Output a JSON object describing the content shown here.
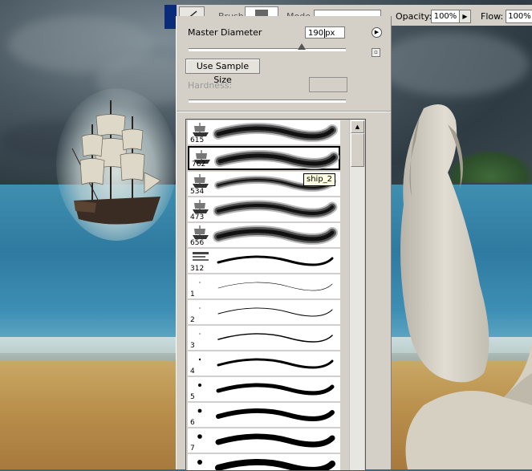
{
  "options_bar": {
    "opacity_label": "Opacity:",
    "opacity_value": "100%",
    "flow_label": "Flow:",
    "flow_value": "100%",
    "mode_label": "Mode",
    "brush_label": "Brush"
  },
  "brush_panel": {
    "master_diameter_label": "Master Diameter",
    "master_diameter_value": "190",
    "master_diameter_unit": "px",
    "master_diameter_fraction": 0.72,
    "use_sample_size_label": "Use Sample Size",
    "hardness_label": "Hardness:",
    "menu_icon": "right-arrow-circle-icon",
    "restore_icon": "small-square-icon"
  },
  "brushes": [
    {
      "size": "615",
      "thumb": "ship",
      "stroke": "texture",
      "thickness": 10
    },
    {
      "size": "762",
      "thumb": "ship",
      "stroke": "texture",
      "thickness": 10,
      "selected": true
    },
    {
      "size": "534",
      "thumb": "ship",
      "stroke": "texture-thin",
      "thickness": 6
    },
    {
      "size": "473",
      "thumb": "ship",
      "stroke": "texture",
      "thickness": 9
    },
    {
      "size": "656",
      "thumb": "ship",
      "stroke": "texture",
      "thickness": 10
    },
    {
      "size": "312",
      "thumb": "text",
      "stroke": "solid",
      "thickness": 3
    },
    {
      "size": "1",
      "thumb": "dot",
      "stroke": "solid",
      "thickness": 0.6
    },
    {
      "size": "2",
      "thumb": "dot",
      "stroke": "solid",
      "thickness": 1
    },
    {
      "size": "3",
      "thumb": "dot",
      "stroke": "solid",
      "thickness": 1.5
    },
    {
      "size": "4",
      "thumb": "dot",
      "stroke": "solid",
      "thickness": 3
    },
    {
      "size": "5",
      "thumb": "dot",
      "stroke": "solid",
      "thickness": 5
    },
    {
      "size": "6",
      "thumb": "dot",
      "stroke": "solid",
      "thickness": 6
    },
    {
      "size": "7",
      "thumb": "dot",
      "stroke": "solid",
      "thickness": 7
    },
    {
      "size": "",
      "thumb": "dot",
      "stroke": "solid",
      "thickness": 8
    }
  ],
  "tooltip": "ship_2",
  "colors": {
    "panel": "#d4d0c8",
    "tooltip": "#ffffe1",
    "stroke": "#000000"
  }
}
